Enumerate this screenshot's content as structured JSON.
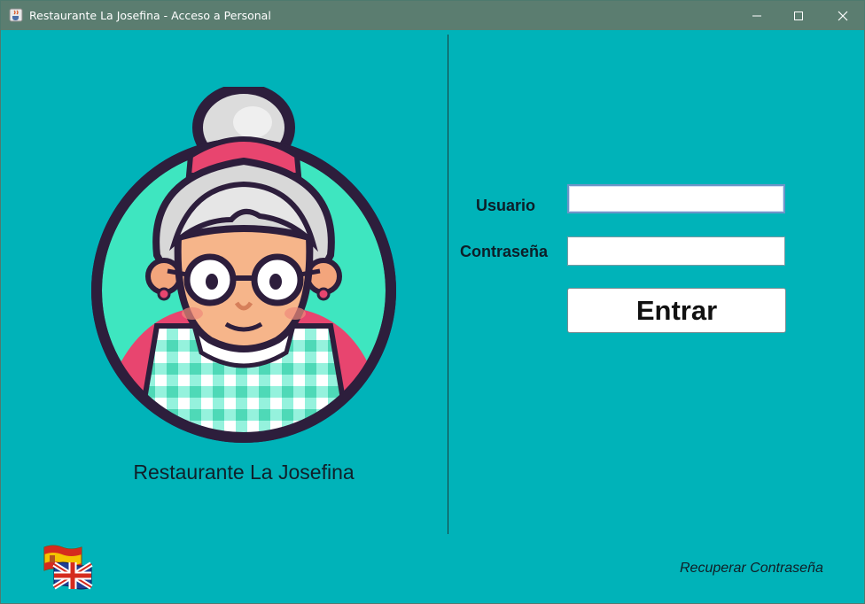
{
  "window": {
    "title": "Restaurante La Josefina - Acceso a Personal",
    "icon": "java-cup-icon",
    "controls": [
      "minimize-icon",
      "maximize-icon",
      "close-icon"
    ]
  },
  "brand": {
    "name": "Restaurante La Josefina",
    "image": "grandma-chef-avatar"
  },
  "login": {
    "user_label": "Usuario",
    "user_value": "",
    "password_label": "Contraseña",
    "password_value": "",
    "submit_label": "Entrar"
  },
  "footer": {
    "recover_link": "Recuperar Contraseña",
    "languages": [
      "spain-flag-icon",
      "uk-flag-icon"
    ]
  },
  "colors": {
    "background": "#00b3b9",
    "titlebar": "#5b7d70",
    "avatar_ring": "#2d1e3c",
    "avatar_circle": "#3ee6c0"
  }
}
